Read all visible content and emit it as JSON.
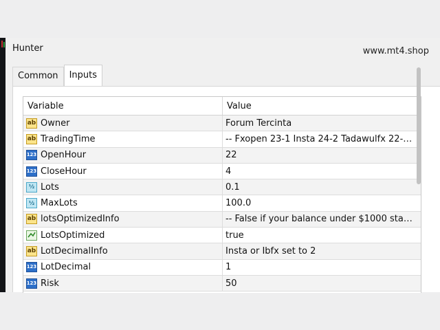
{
  "window": {
    "title": "Hunter",
    "watermark": "www.mt4.shop"
  },
  "tabs": [
    {
      "label": "Common"
    },
    {
      "label": "Inputs"
    }
  ],
  "grid": {
    "headers": {
      "variable": "Variable",
      "value": "Value"
    },
    "rows": [
      {
        "icon": "ab",
        "variable": "Owner",
        "value": "Forum Tercinta"
      },
      {
        "icon": "ab",
        "variable": "TradingTime",
        "value": "-- Fxopen 23-1 Insta 24-2 Tadawulfx 22-2..."
      },
      {
        "icon": "123",
        "variable": "OpenHour",
        "value": "22"
      },
      {
        "icon": "123",
        "variable": "CloseHour",
        "value": "4"
      },
      {
        "icon": "½",
        "variable": "Lots",
        "value": "0.1"
      },
      {
        "icon": "½",
        "variable": "MaxLots",
        "value": "100.0"
      },
      {
        "icon": "ab",
        "variable": "lotsOptimizedInfo",
        "value": "-- False if your balance under $1000 stan..."
      },
      {
        "icon": "bool",
        "variable": "LotsOptimized",
        "value": "true"
      },
      {
        "icon": "ab",
        "variable": "LotDecimalInfo",
        "value": "Insta or Ibfx set to 2"
      },
      {
        "icon": "123",
        "variable": "LotDecimal",
        "value": "1"
      },
      {
        "icon": "123",
        "variable": "Risk",
        "value": "50"
      }
    ]
  }
}
